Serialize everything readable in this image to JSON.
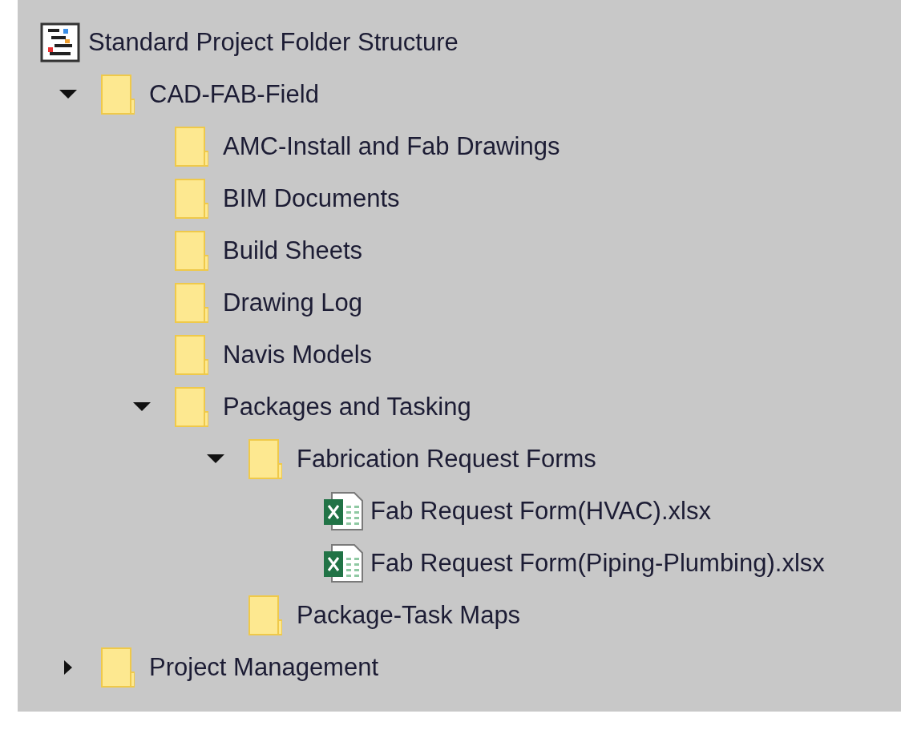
{
  "tree": [
    {
      "label": "Standard Project Folder Structure",
      "kind": "project",
      "children": [
        {
          "label": "CAD-FAB-Field",
          "kind": "folder",
          "expanded": true,
          "children": [
            {
              "label": "AMC-Install and Fab Drawings",
              "kind": "folder"
            },
            {
              "label": "BIM Documents",
              "kind": "folder"
            },
            {
              "label": "Build Sheets",
              "kind": "folder"
            },
            {
              "label": "Drawing Log",
              "kind": "folder"
            },
            {
              "label": "Navis Models",
              "kind": "folder"
            },
            {
              "label": "Packages and Tasking",
              "kind": "folder",
              "expanded": true,
              "children": [
                {
                  "label": "Fabrication Request Forms",
                  "kind": "folder",
                  "expanded": true,
                  "children": [
                    {
                      "label": "Fab Request Form(HVAC).xlsx",
                      "kind": "excel"
                    },
                    {
                      "label": "Fab Request Form(Piping-Plumbing).xlsx",
                      "kind": "excel"
                    }
                  ]
                },
                {
                  "label": "Package-Task Maps",
                  "kind": "folder"
                }
              ]
            }
          ]
        },
        {
          "label": "Project Management",
          "kind": "folder",
          "expanded": false
        }
      ]
    }
  ]
}
